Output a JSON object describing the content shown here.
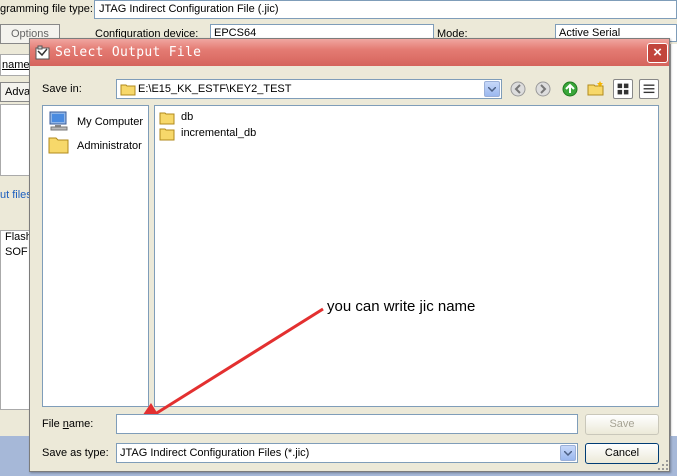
{
  "background": {
    "prog_type_label": "gramming file type:",
    "prog_type_value": "JTAG Indirect Configuration File (.jic)",
    "options_label": "Options",
    "config_device_label": "Configuration device:",
    "config_device_value": "EPCS64",
    "mode_label": "Mode:",
    "mode_value": "Active Serial",
    "name_label": "name",
    "advanced_label": "Adva",
    "files_label": "ut files",
    "list_items": [
      "Flash",
      "SOF"
    ]
  },
  "dialog": {
    "title": "Select Output File",
    "close_label": "×",
    "save_in_label": "Save in:",
    "save_in_path": "E:\\E15_KK_ESTF\\KEY2_TEST",
    "toolbar": {
      "back_icon": "back-icon",
      "forward_icon": "forward-icon",
      "up_icon": "up-folder-icon",
      "new_folder_icon": "new-folder-icon",
      "view_icon": "view-icons-icon",
      "list_icon": "list-view-icon"
    },
    "places": [
      {
        "label": "My Computer",
        "icon": "computer-icon"
      },
      {
        "label": "Administrator",
        "icon": "folder-icon"
      }
    ],
    "files": [
      {
        "name": "db",
        "icon": "folder-icon"
      },
      {
        "name": "incremental_db",
        "icon": "folder-icon"
      }
    ],
    "annotation": "you can write jic name",
    "file_name_label_pre": "File ",
    "file_name_label_u": "n",
    "file_name_label_post": "ame:",
    "file_name_value": "",
    "save_button": "Save",
    "save_as_type_label": "Save as type:",
    "save_as_type_value": "JTAG Indirect Configuration Files (*.jic)",
    "cancel_button": "Cancel",
    "colors": {
      "titlebar": "#d5645c",
      "arrow": "#e33030",
      "link": "#1c5fbf"
    }
  }
}
